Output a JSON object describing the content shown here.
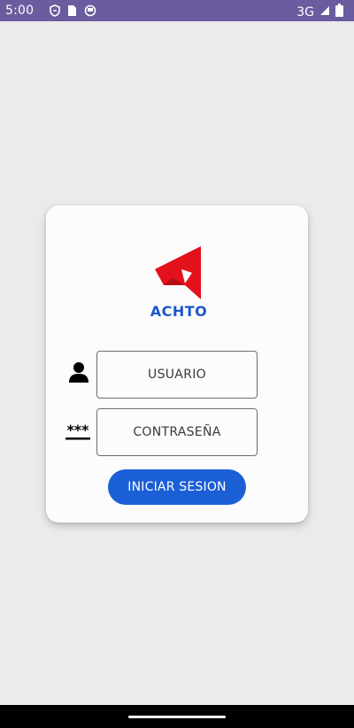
{
  "status_bar": {
    "time": "5:00",
    "network": "3G",
    "left_icons": [
      "shield-icon",
      "sim-card-icon",
      "sync-icon"
    ],
    "right_icons": [
      "signal-icon",
      "battery-icon"
    ]
  },
  "login": {
    "logo_text": "ACHTO",
    "logo_color": "#e3111b",
    "brand_color": "#1b57c9",
    "username_placeholder": "USUARIO",
    "password_placeholder": "CONTRASEÑA",
    "password_icon_text": "***",
    "submit_label": "INICIAR SESION",
    "button_color": "#1b5fd6"
  }
}
